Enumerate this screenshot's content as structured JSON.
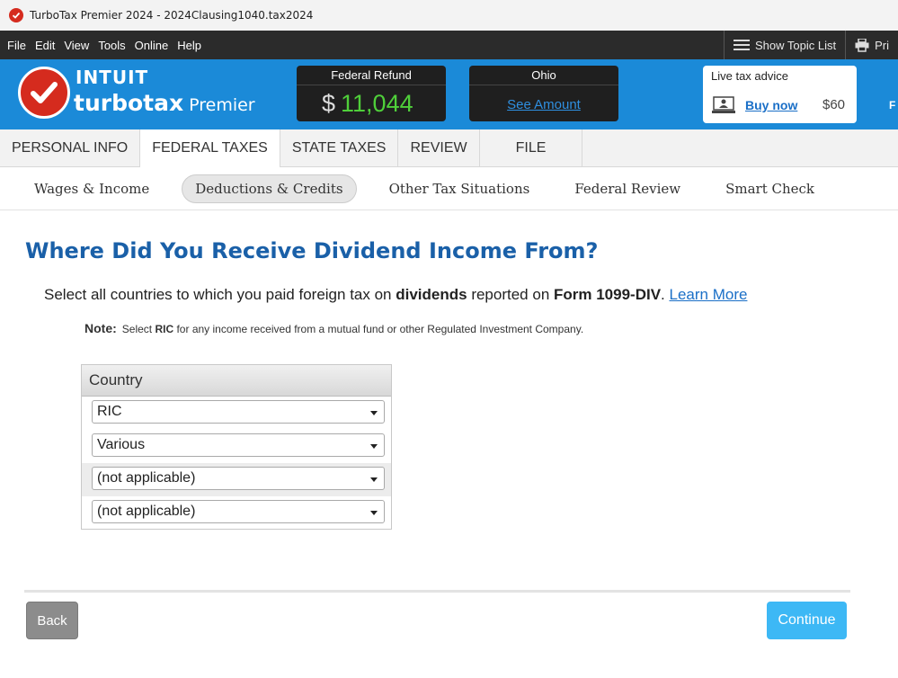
{
  "window": {
    "title": "TurboTax Premier 2024 - 2024Clausing1040.tax2024"
  },
  "menu": {
    "items": [
      "File",
      "Edit",
      "View",
      "Tools",
      "Online",
      "Help"
    ],
    "show_topic_list": "Show Topic List",
    "print_truncated": "Pri"
  },
  "brand": {
    "intuit": "INTUIT",
    "product": "turbotax",
    "edition": "Premier"
  },
  "refund": {
    "label": "Federal Refund",
    "currency": "$",
    "amount": "11,044"
  },
  "state": {
    "label": "Ohio",
    "link": "See Amount"
  },
  "advice": {
    "label": "Live tax advice",
    "buy": "Buy now",
    "price": "$60"
  },
  "header_edge": "F",
  "tabs": [
    "PERSONAL INFO",
    "FEDERAL TAXES",
    "STATE TAXES",
    "REVIEW",
    "FILE"
  ],
  "active_tab": "FEDERAL TAXES",
  "subtabs": [
    "Wages & Income",
    "Deductions & Credits",
    "Other Tax Situations",
    "Federal Review",
    "Smart Check"
  ],
  "active_subtab": "Deductions & Credits",
  "content": {
    "title": "Where Did You Receive Dividend Income From?",
    "instruction_pre": "Select all countries to which you paid foreign tax on ",
    "instruction_bold1": "dividends",
    "instruction_mid": " reported on ",
    "instruction_bold2": "Form 1099-DIV",
    "instruction_post": ". ",
    "learn_more": "Learn More",
    "note_label": "Note:",
    "note_pre": "Select ",
    "note_bold": "RIC",
    "note_post": " for any income received from a mutual fund or other Regulated Investment Company."
  },
  "table": {
    "header": "Country",
    "rows": [
      "RIC",
      "Various",
      "(not applicable)",
      "(not applicable)"
    ]
  },
  "buttons": {
    "back": "Back",
    "continue": "Continue"
  },
  "colors": {
    "brand_blue": "#1b8ad8",
    "logo_red": "#d52b1e",
    "refund_green": "#4fcf3a",
    "title_blue": "#1a60a8",
    "continue_blue": "#3db8f5"
  }
}
